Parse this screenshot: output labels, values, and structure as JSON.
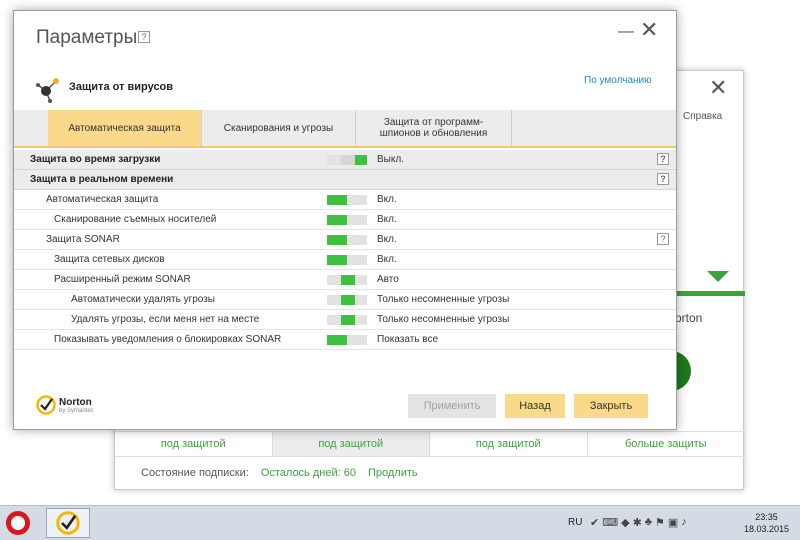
{
  "background_window": {
    "help_label": "Справка",
    "brand_fragment": "orton",
    "status_cells": [
      "под защитой",
      "под защитой",
      "под защитой",
      "больше защиты"
    ],
    "subscription_label": "Состояние подписки:",
    "days_left": "Осталось дней: 60",
    "renew_link": "Продлить"
  },
  "dialog": {
    "title": "Параметры",
    "help_icon": "?",
    "section_title": "Защита от вирусов",
    "defaults_link": "По умолчанию",
    "tabs": [
      {
        "label": "Автоматическая защита",
        "active": true
      },
      {
        "label": "Сканирования и угрозы",
        "active": false
      },
      {
        "label": "Защита от программ-шпионов и обновления",
        "active": false
      }
    ],
    "rows": [
      {
        "label": "Защита во время загрузки",
        "value": "Выкл.",
        "state": "off",
        "section": true,
        "help": true
      },
      {
        "label": "Защита в реальном времени",
        "value": "",
        "state": "",
        "section": true,
        "help": true
      },
      {
        "label": "Автоматическая защита",
        "value": "Вкл.",
        "state": "on"
      },
      {
        "label": "Сканирование съемных носителей",
        "value": "Вкл.",
        "state": "on"
      },
      {
        "label": "Защита SONAR",
        "value": "Вкл.",
        "state": "on",
        "help": true
      },
      {
        "label": "Защита сетевых дисков",
        "value": "Вкл.",
        "state": "on"
      },
      {
        "label": "Расширенный режим SONAR",
        "value": "Авто",
        "state": "auto"
      },
      {
        "label": "Автоматически удалять угрозы",
        "value": "Только несомненные угрозы",
        "state": "auto"
      },
      {
        "label": "Удалять угрозы, если меня нет на месте",
        "value": "Только несомненные угрозы",
        "state": "auto"
      },
      {
        "label": "Показывать уведомления о блокировках SONAR",
        "value": "Показать все",
        "state": "on"
      }
    ],
    "logo_name": "Norton",
    "logo_by": "by Symantec",
    "buttons": {
      "apply": "Применить",
      "back": "Назад",
      "ok": "Закрыть"
    }
  },
  "taskbar": {
    "language": "RU",
    "time": "23:35",
    "date": "18.03.2015"
  },
  "colors": {
    "accent_yellow": "#fbd98a",
    "toggle_green": "#3ec13e",
    "status_green": "#3aa33a",
    "link_blue": "#2b86c4"
  }
}
